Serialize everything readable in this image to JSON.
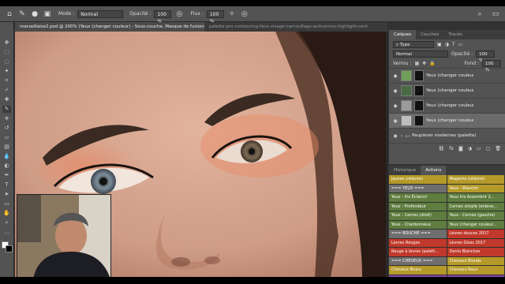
{
  "options_bar": {
    "mode_label": "Mode :",
    "mode_value": "Normal",
    "opacity_label": "Opacité :",
    "opacity_value": "100 %",
    "flow_label": "Flux :",
    "flow_value": "100 %"
  },
  "document_tabs": [
    {
      "label": "marseillaise2.psd @ 200% (Yeux (changer couleur) - Sous-couche, Masque de fusion/8) *",
      "active": true
    },
    {
      "label": "palette-pro-contouring-face-visage-camouflage-anticernes-highlight-cont",
      "active": false
    }
  ],
  "layers_panel": {
    "tabs": [
      "Calques",
      "Couches",
      "Tracés"
    ],
    "filter": "Type",
    "blend_mode": "Normal",
    "opacity_label": "Opacité :",
    "opacity_value": "100 %",
    "lock_label": "Verrou :",
    "fill_label": "Fond :",
    "fill_value": "100 %",
    "layers": [
      {
        "name": "Yeux (changer couleur) - V...",
        "thumb_color": "#6f9e59",
        "selected": false
      },
      {
        "name": "Yeux (changer couleur) - V...",
        "thumb_color": "#4a6a45",
        "selected": false
      },
      {
        "name": "Yeux (changer couleur) - E...",
        "thumb_color": "#9b9b9b",
        "selected": false
      },
      {
        "name": "Yeux (changer couleur) - S...",
        "thumb_color": "#bdbdbd",
        "selected": true
      }
    ],
    "group_name": "Paupières modernes (palette)"
  },
  "actions_panel": {
    "tabs": [
      "Historique",
      "Actions"
    ],
    "items": [
      [
        "Jaunes (réduire)",
        "#b59a2a",
        "Magenta (réduire)",
        "#b59a2a"
      ],
      [
        "=== YEUX ===",
        "#6e6e6e",
        "Yeux - Blanchir",
        "#b59a2a"
      ],
      [
        "Yeux - Iris Éclaircir",
        "#5f7d3f",
        "Yeux Iris Assombrir 2...",
        "#5f7d3f"
      ],
      [
        "Yeux - Profondeur",
        "#5f7d3f",
        "Cernes simple (enleve...",
        "#5f7d3f"
      ],
      [
        "Yeux - Cernes (droit)",
        "#5f7d3f",
        "Yeux - Cernes (gauche)",
        "#5f7d3f"
      ],
      [
        "Yeux - Charbonneux",
        "#5f7d3f",
        "Yeux (changer couleur...",
        "#5f7d3f"
      ],
      [
        "=== BOUCHE ===",
        "#6e6e6e",
        "Lèvres douces 2017",
        "#c0392b"
      ],
      [
        "Lèvres Rouges",
        "#c0392b",
        "Lèvres Gloss 2017",
        "#c0392b"
      ],
      [
        "Rouge à lèvres (palett...",
        "#c0392b",
        "Dents Blanches",
        "#c0392b"
      ],
      [
        "=== CHEVEUX ===",
        "#6e6e6e",
        "Cheveux Blonds",
        "#b59a2a"
      ],
      [
        "Cheveux Bruns",
        "#b59a2a",
        "Cheveux Roux",
        "#b59a2a"
      ],
      [
        "Poils",
        "#8e44ad",
        "Poils Intenses",
        "#8e44ad"
      ],
      [
        "=== MAQUILLAGE ===",
        "#6e6e6e",
        "Contouring 2017",
        "#c77d1e"
      ]
    ]
  },
  "colors": {
    "ui_dark": "#323232",
    "ui_mid": "#535353",
    "skin": "#d9a994"
  }
}
